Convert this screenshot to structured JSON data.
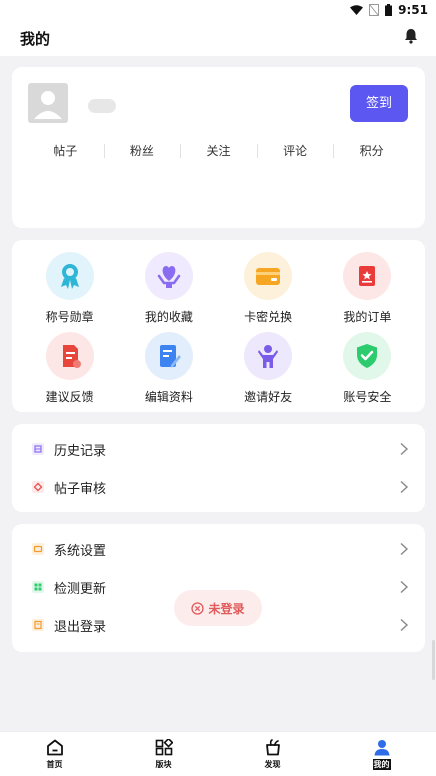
{
  "status_bar": {
    "time": "9:51"
  },
  "header": {
    "title": "我的"
  },
  "profile": {
    "checkin_label": "签到",
    "stats": [
      {
        "label": "帖子"
      },
      {
        "label": "粉丝"
      },
      {
        "label": "关注"
      },
      {
        "label": "评论"
      },
      {
        "label": "积分"
      }
    ]
  },
  "grid": {
    "items": [
      {
        "label": "称号勋章",
        "icon": "medal-icon"
      },
      {
        "label": "我的收藏",
        "icon": "heart-hand-icon"
      },
      {
        "label": "卡密兑换",
        "icon": "card-icon"
      },
      {
        "label": "我的订单",
        "icon": "order-icon"
      },
      {
        "label": "建议反馈",
        "icon": "feedback-icon"
      },
      {
        "label": "编辑资料",
        "icon": "edit-profile-icon"
      },
      {
        "label": "邀请好友",
        "icon": "invite-icon"
      },
      {
        "label": "账号安全",
        "icon": "shield-check-icon"
      }
    ]
  },
  "list1": [
    {
      "label": "历史记录",
      "icon": "history-icon"
    },
    {
      "label": "帖子审核",
      "icon": "review-icon"
    }
  ],
  "list2": [
    {
      "label": "系统设置",
      "icon": "settings-icon"
    },
    {
      "label": "检测更新",
      "icon": "update-icon"
    },
    {
      "label": "退出登录",
      "icon": "logout-icon"
    }
  ],
  "toast": {
    "text": "未登录"
  },
  "tabbar": {
    "items": [
      {
        "label": "首页",
        "icon": "home-icon"
      },
      {
        "label": "版块",
        "icon": "blocks-icon"
      },
      {
        "label": "发现",
        "icon": "discover-icon"
      },
      {
        "label": "我的",
        "icon": "user-icon",
        "active": true
      }
    ]
  },
  "colors": {
    "accent": "#5b57f0",
    "toast": "#e05a5a"
  }
}
